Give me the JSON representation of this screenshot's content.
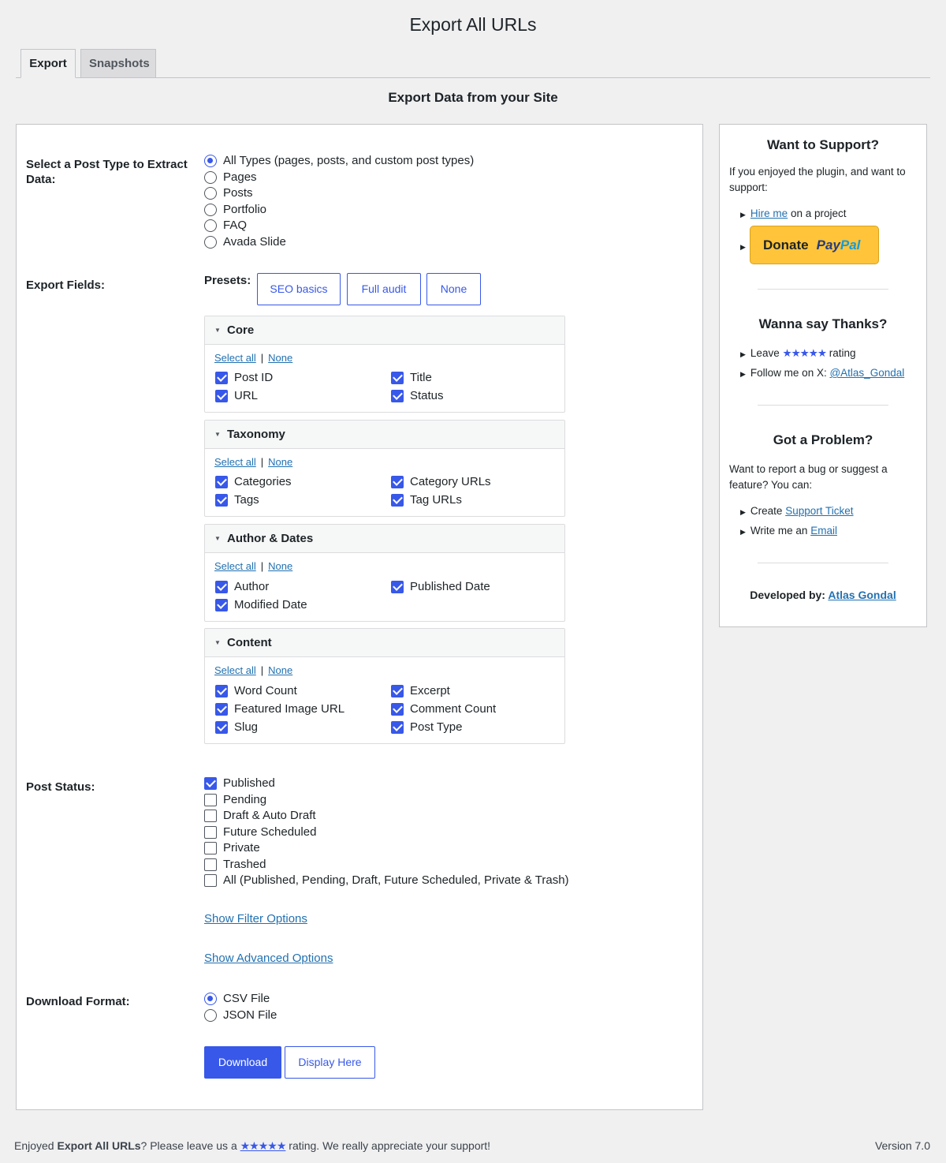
{
  "page": {
    "title": "Export All URLs",
    "subtitle": "Export Data from your Site"
  },
  "tabs": [
    {
      "label": "Export",
      "active": true
    },
    {
      "label": "Snapshots",
      "active": false
    }
  ],
  "post_type": {
    "label": "Select a Post Type to Extract Data:",
    "options": [
      {
        "label": "All Types (pages, posts, and custom post types)",
        "selected": true
      },
      {
        "label": "Pages",
        "selected": false
      },
      {
        "label": "Posts",
        "selected": false
      },
      {
        "label": "Portfolio",
        "selected": false
      },
      {
        "label": "FAQ",
        "selected": false
      },
      {
        "label": "Avada Slide",
        "selected": false
      }
    ]
  },
  "export_fields": {
    "label": "Export Fields:",
    "presets_label": "Presets:",
    "presets": [
      "SEO basics",
      "Full audit",
      "None"
    ],
    "select_all": "Select all",
    "none": "None",
    "groups": [
      {
        "title": "Core",
        "fields": [
          {
            "label": "Post ID",
            "checked": true
          },
          {
            "label": "Title",
            "checked": true
          },
          {
            "label": "URL",
            "checked": true
          },
          {
            "label": "Status",
            "checked": true
          }
        ]
      },
      {
        "title": "Taxonomy",
        "fields": [
          {
            "label": "Categories",
            "checked": true
          },
          {
            "label": "Category URLs",
            "checked": true
          },
          {
            "label": "Tags",
            "checked": true
          },
          {
            "label": "Tag URLs",
            "checked": true
          }
        ]
      },
      {
        "title": "Author & Dates",
        "fields": [
          {
            "label": "Author",
            "checked": true
          },
          {
            "label": "Published Date",
            "checked": true
          },
          {
            "label": "Modified Date",
            "checked": true
          }
        ]
      },
      {
        "title": "Content",
        "fields": [
          {
            "label": "Word Count",
            "checked": true
          },
          {
            "label": "Excerpt",
            "checked": true
          },
          {
            "label": "Featured Image URL",
            "checked": true
          },
          {
            "label": "Comment Count",
            "checked": true
          },
          {
            "label": "Slug",
            "checked": true
          },
          {
            "label": "Post Type",
            "checked": true
          }
        ]
      }
    ]
  },
  "post_status": {
    "label": "Post Status:",
    "options": [
      {
        "label": "Published",
        "checked": true
      },
      {
        "label": "Pending",
        "checked": false
      },
      {
        "label": "Draft & Auto Draft",
        "checked": false
      },
      {
        "label": "Future Scheduled",
        "checked": false
      },
      {
        "label": "Private",
        "checked": false
      },
      {
        "label": "Trashed",
        "checked": false
      },
      {
        "label": "All (Published, Pending, Draft, Future Scheduled, Private & Trash)",
        "checked": false
      }
    ]
  },
  "links": {
    "filter": "Show Filter Options",
    "advanced": "Show Advanced Options"
  },
  "download_format": {
    "label": "Download Format:",
    "options": [
      {
        "label": "CSV File",
        "selected": true
      },
      {
        "label": "JSON File",
        "selected": false
      }
    ]
  },
  "buttons": {
    "download": "Download",
    "display": "Display Here"
  },
  "sidebar": {
    "support": {
      "title": "Want to Support?",
      "text": "If you enjoyed the plugin, and want to support:",
      "hire_link": "Hire me",
      "hire_rest": " on a project",
      "donate": "Donate",
      "paypal_a": "Pay",
      "paypal_b": "Pal"
    },
    "thanks": {
      "title": "Wanna say Thanks?",
      "leave": "Leave ",
      "stars": "★★★★★",
      "rating": " rating",
      "follow": "Follow me on X: ",
      "handle": "@Atlas_Gondal"
    },
    "problem": {
      "title": "Got a Problem?",
      "text": "Want to report a bug or suggest a feature? You can:",
      "create": "Create ",
      "ticket": "Support Ticket",
      "write": "Write me an ",
      "email": "Email"
    },
    "dev_label": "Developed by:",
    "dev_name": "Atlas Gondal"
  },
  "footer": {
    "pre": "Enjoyed ",
    "plugin": "Export All URLs",
    "mid": "? Please leave us a ",
    "stars": "★★★★★",
    "post": " rating. We really appreciate your support!",
    "version": "Version 7.0"
  },
  "colors": {
    "accent": "#3858e9",
    "link": "#2271b1",
    "donate": "#ffc439"
  }
}
